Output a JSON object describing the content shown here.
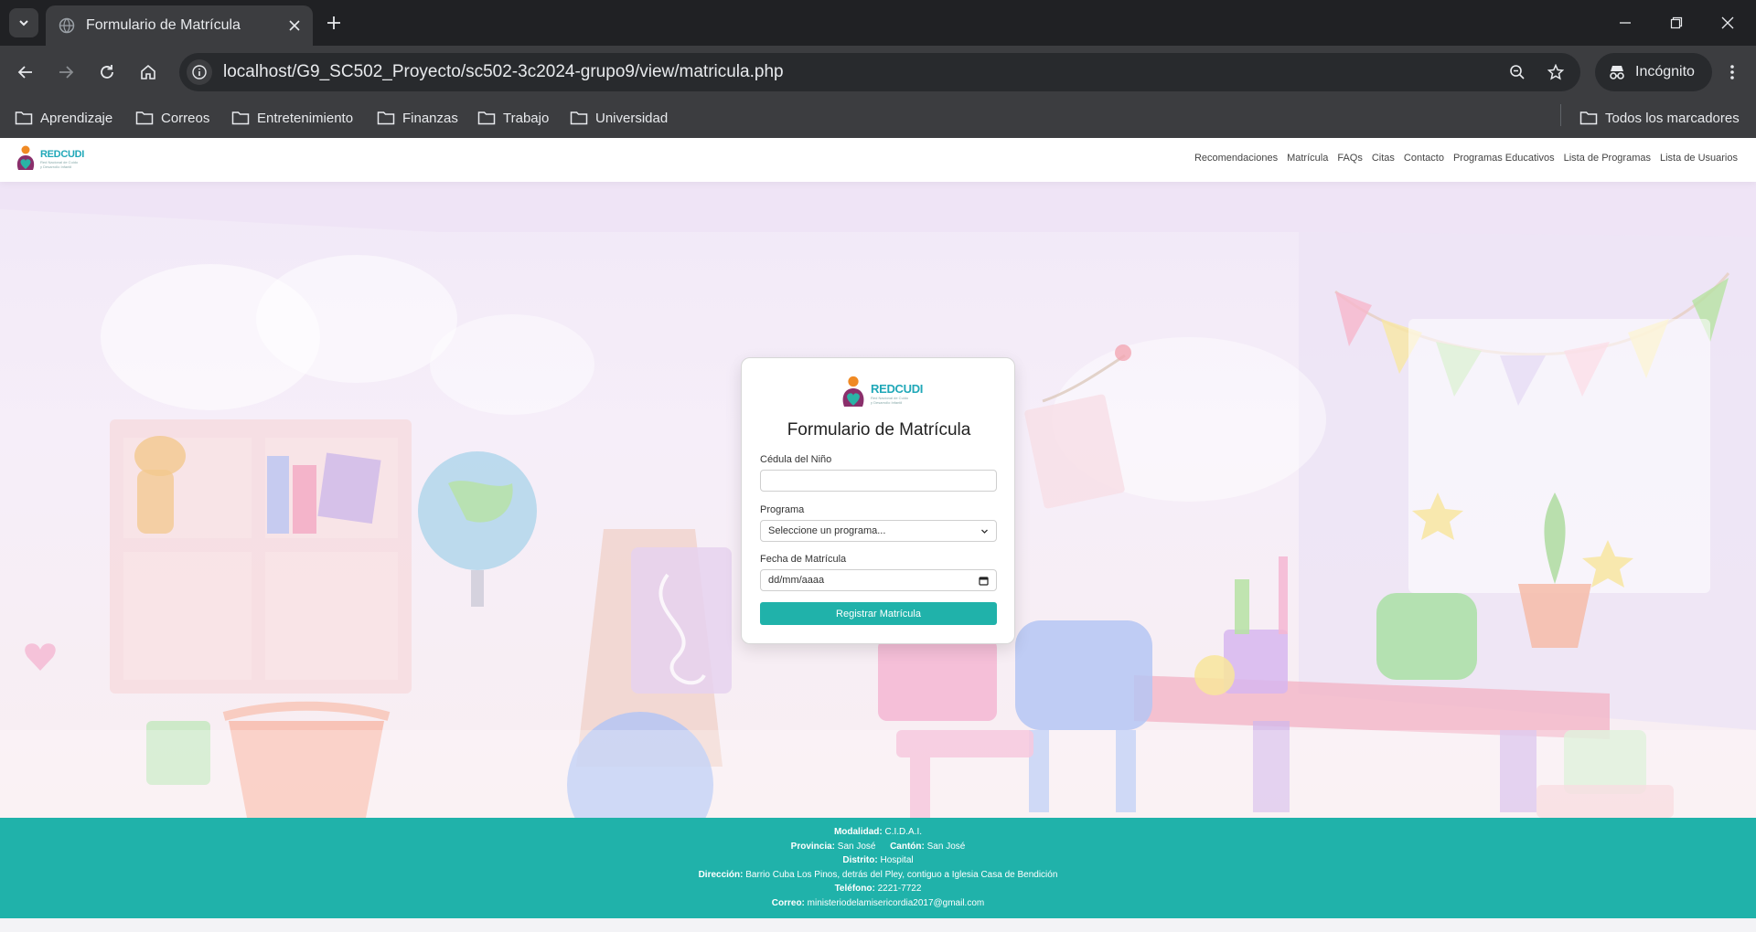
{
  "browser": {
    "tab_title": "Formulario de Matrícula",
    "url": "localhost/G9_SC502_Proyecto/sc502-3c2024-grupo9/view/matricula.php",
    "incognito_label": "Incógnito",
    "bookmarks": [
      "Aprendizaje",
      "Correos",
      "Entretenimiento",
      "Finanzas",
      "Trabajo",
      "Universidad"
    ],
    "all_bookmarks_label": "Todos los marcadores"
  },
  "site": {
    "logo_text": "REDCUDI",
    "logo_subtitle_1": "Red Nacional de Cuido",
    "logo_subtitle_2": "y Desarrollo Infantil",
    "nav": [
      "Recomendaciones",
      "Matrícula",
      "FAQs",
      "Citas",
      "Contacto",
      "Programas Educativos",
      "Lista de Programas",
      "Lista de Usuarios"
    ]
  },
  "form": {
    "title": "Formulario de Matrícula",
    "cedula_label": "Cédula del Niño",
    "cedula_value": "",
    "programa_label": "Programa",
    "programa_placeholder": "Seleccione un programa...",
    "fecha_label": "Fecha de Matrícula",
    "fecha_placeholder": "dd/mm/aaaa",
    "submit_label": "Registrar Matrícula"
  },
  "footer": {
    "modalidad_label": "Modalidad:",
    "modalidad_value": "C.I.D.A.I.",
    "provincia_label": "Provincia:",
    "provincia_value": "San José",
    "canton_label": "Cantón:",
    "canton_value": "San José",
    "distrito_label": "Distrito:",
    "distrito_value": "Hospital",
    "direccion_label": "Dirección:",
    "direccion_value": "Barrio Cuba Los Pinos, detrás del Pley, contiguo a Iglesia Casa de Bendición",
    "telefono_label": "Teléfono:",
    "telefono_value": "2221-7722",
    "correo_label": "Correo:",
    "correo_value": "ministeriodelamisericordia2017@gmail.com"
  },
  "colors": {
    "accent": "#20b2aa",
    "chrome_dark": "#202124",
    "chrome_toolbar": "#3c3d40"
  }
}
